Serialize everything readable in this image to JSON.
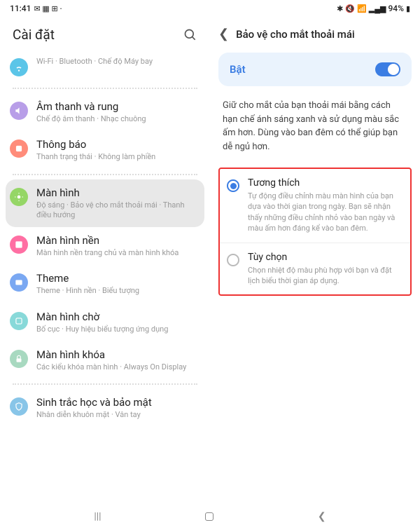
{
  "status": {
    "time": "11:41",
    "battery": "94%"
  },
  "left": {
    "title": "Cài đặt",
    "items": [
      {
        "title": "",
        "sub": "Wi-Fi · Bluetooth · Chế độ Máy bay"
      },
      {
        "title": "Âm thanh và rung",
        "sub": "Chế độ âm thanh · Nhạc chuông"
      },
      {
        "title": "Thông báo",
        "sub": "Thanh trạng thái · Không làm phiền"
      },
      {
        "title": "Màn hình",
        "sub": "Độ sáng · Bảo vệ cho mắt thoải mái · Thanh điều hướng"
      },
      {
        "title": "Màn hình nền",
        "sub": "Màn hình nền trang chủ và màn hình khóa"
      },
      {
        "title": "Theme",
        "sub": "Theme · Hình nền · Biểu tượng"
      },
      {
        "title": "Màn hình chờ",
        "sub": "Bố cục · Huy hiệu biểu tượng ứng dụng"
      },
      {
        "title": "Màn hình khóa",
        "sub": "Các kiểu khóa màn hình · Always On Display"
      },
      {
        "title": "Sinh trắc học và bảo mật",
        "sub": "Nhân diễn khuôn mặt · Vân tay"
      }
    ]
  },
  "right": {
    "title": "Bảo vệ cho mắt thoải mái",
    "toggle_label": "Bật",
    "description": "Giữ cho mắt của bạn thoải mái bằng cách hạn chế ánh sáng xanh và sử dụng màu sắc ấm hơn. Dùng vào ban đêm có thể giúp bạn dễ ngủ hơn.",
    "options": [
      {
        "title": "Tương thích",
        "desc": "Tự động điều chỉnh màu màn hình của bạn dựa vào thời gian trong ngày. Bạn sẽ nhận thấy những điều chỉnh nhỏ vào ban ngày và màu ấm hơn đáng kể vào ban đêm."
      },
      {
        "title": "Tùy chọn",
        "desc": "Chọn nhiệt độ màu phù hợp với bạn và đặt lịch biểu thời gian áp dụng."
      }
    ]
  }
}
